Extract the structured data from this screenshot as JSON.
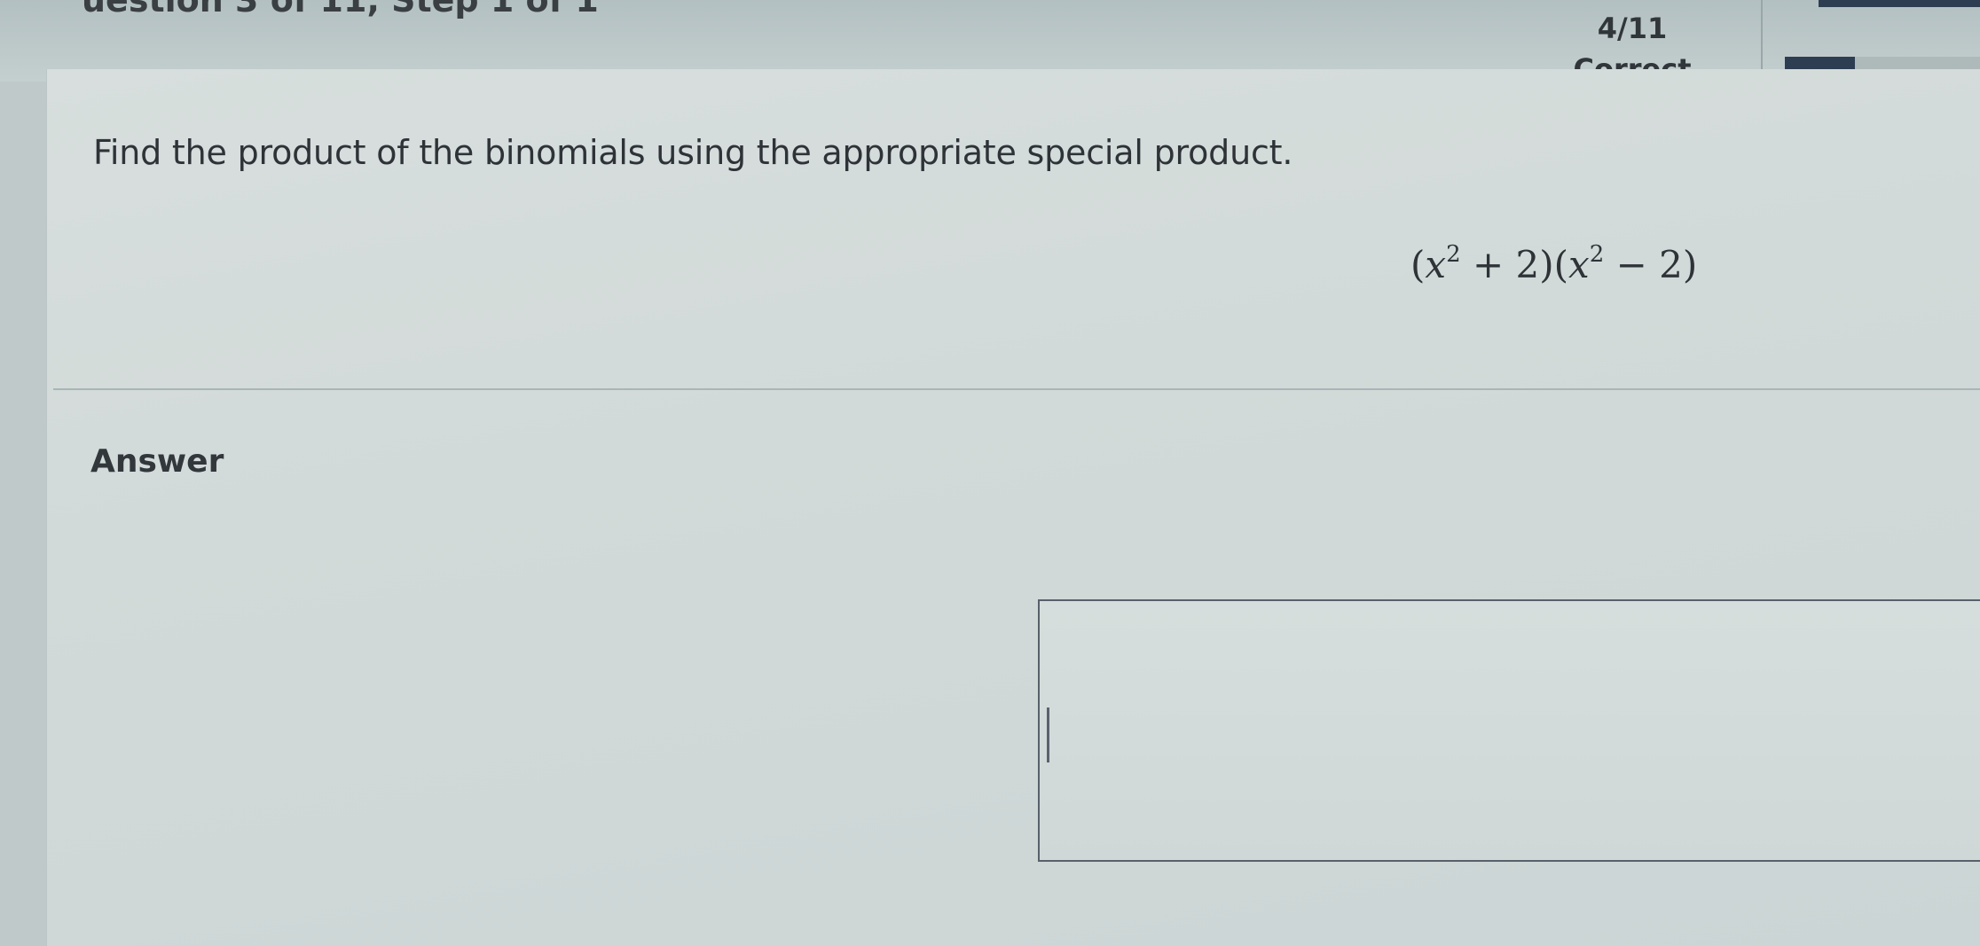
{
  "header": {
    "question_step": "uestion 3 of 11,  Step 1 of 1",
    "progress_count": "4/11",
    "progress_status": "Correct",
    "progress_fraction": 0.36
  },
  "question": {
    "prompt": "Find the product of the binomials using the appropriate special product.",
    "expression": {
      "open1": "(",
      "base1": "x",
      "exp1": "2",
      "rest1": " + 2)(",
      "base2": "x",
      "exp2": "2",
      "rest2": " − 2)"
    }
  },
  "answer": {
    "label": "Answer",
    "value": ""
  },
  "colors": {
    "accent": "#2d3e52",
    "card_bg": "#d4dcdb",
    "header_bg": "#b8c4c5"
  }
}
